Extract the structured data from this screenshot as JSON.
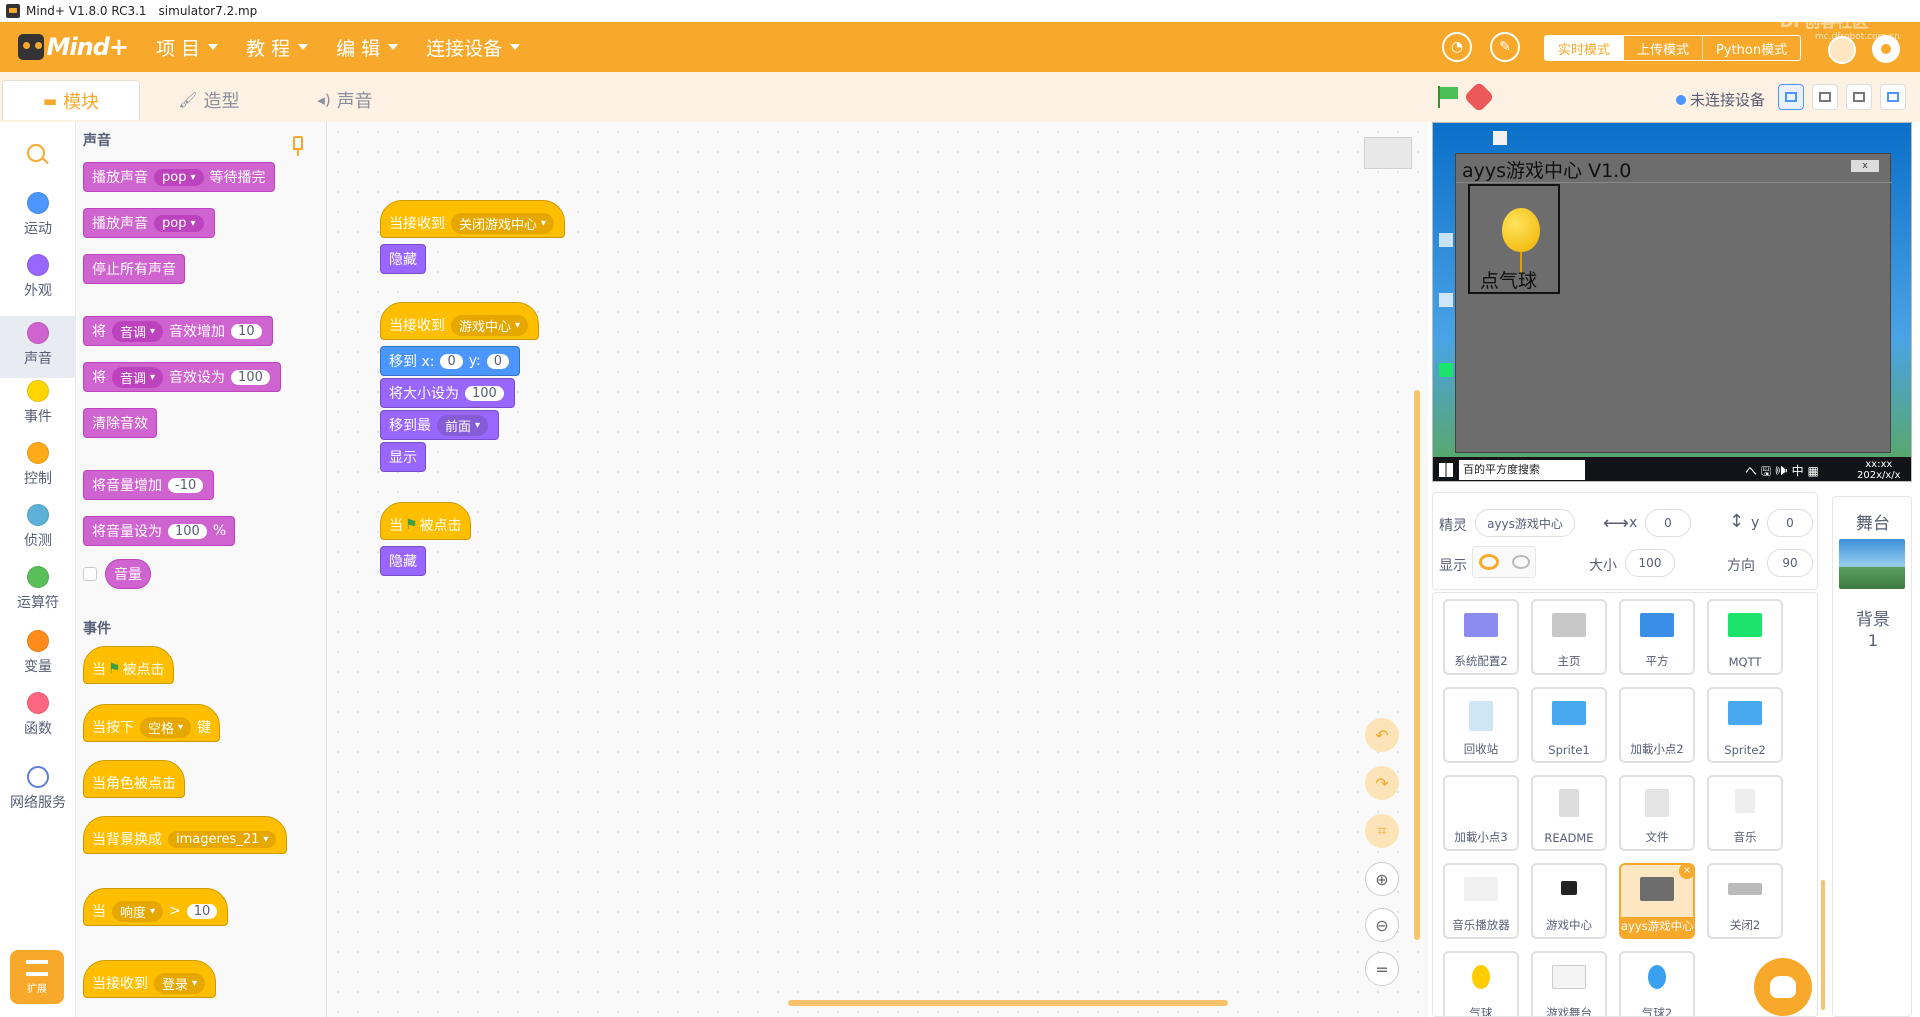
{
  "window": {
    "app": "Mind+ V1.8.0 RC3.1",
    "file": "simulator7.2.mp"
  },
  "menubar": {
    "logo": "Mind+",
    "items": [
      "项 目",
      "教 程",
      "编 辑",
      "连接设备"
    ],
    "modes": [
      "实时模式",
      "上传模式",
      "Python模式"
    ],
    "watermark": "DF创客社区",
    "watermark_sub": "mc.dfrobot.com.cn"
  },
  "tabs": [
    {
      "label": "模块",
      "icon": "blocks-icon"
    },
    {
      "label": "造型",
      "icon": "brush-icon"
    },
    {
      "label": "声音",
      "icon": "speaker-icon"
    }
  ],
  "categories": [
    {
      "label": "运动",
      "color": "#4c97ff"
    },
    {
      "label": "外观",
      "color": "#9966ff"
    },
    {
      "label": "声音",
      "color": "#cf63cf"
    },
    {
      "label": "事件",
      "color": "#ffd500"
    },
    {
      "label": "控制",
      "color": "#ffab19"
    },
    {
      "label": "侦测",
      "color": "#5cb1d6"
    },
    {
      "label": "运算符",
      "color": "#59c059"
    },
    {
      "label": "变量",
      "color": "#ff8c1a"
    },
    {
      "label": "函数",
      "color": "#ff6680"
    },
    {
      "label": "网络服务",
      "color": "#5b80d6"
    }
  ],
  "extension_label": "扩展",
  "palette": {
    "sound_head": "声音",
    "events_head": "事件",
    "sound": {
      "play_wait": "播放声音",
      "play_wait_val": "pop",
      "play_wait_tail": "等待播完",
      "play": "播放声音",
      "play_val": "pop",
      "stop_all": "停止所有声音",
      "change_effect_pre": "将",
      "change_effect_val": "音调",
      "change_effect_mid": "音效增加",
      "change_effect_num": "10",
      "set_effect_pre": "将",
      "set_effect_val": "音调",
      "set_effect_mid": "音效设为",
      "set_effect_num": "100",
      "clear": "清除音效",
      "change_vol": "将音量增加",
      "change_vol_num": "-10",
      "set_vol": "将音量设为",
      "set_vol_num": "100",
      "set_vol_unit": "%",
      "volume": "音量"
    },
    "events": {
      "flag_pre": "当",
      "flag_post": "被点击",
      "key_pre": "当按下",
      "key_val": "空格",
      "key_post": "键",
      "sprite_clicked": "当角色被点击",
      "backdrop": "当背景换成",
      "backdrop_val": "imageres_21",
      "loud_pre": "当",
      "loud_val": "响度",
      "loud_op": ">",
      "loud_num": "10",
      "receive": "当接收到",
      "receive_val": "登录"
    }
  },
  "scripts": {
    "s1_hat": "当接收到",
    "s1_val": "关闭游戏中心",
    "s1_hide": "隐藏",
    "s2_hat": "当接收到",
    "s2_val": "游戏中心",
    "s2_goto": "移到 x:",
    "s2_x": "0",
    "s2_y_label": "y:",
    "s2_y": "0",
    "s2_size": "将大小设为",
    "s2_size_num": "100",
    "s2_layer": "移到最",
    "s2_layer_val": "前面",
    "s2_show": "显示",
    "s3_pre": "当",
    "s3_post": "被点击",
    "s3_hide": "隐藏"
  },
  "stage_header": {
    "status": "未连接设备"
  },
  "stage": {
    "window_title": "ayys游戏中心 V1.0",
    "close": "x",
    "game_label": "点气球",
    "search_placeholder": "百的平方度搜索",
    "tray": "へ 🖫 🕪 中 ▦",
    "clock_line1": "xx:xx",
    "clock_line2": "202x/x/x"
  },
  "sprite_info": {
    "sprite_label": "精灵",
    "sprite_name": "ayys游戏中心",
    "x_label": "x",
    "x": "0",
    "y_label": "y",
    "y": "0",
    "show_label": "显示",
    "size_label": "大小",
    "size": "100",
    "dir_label": "方向",
    "dir": "90"
  },
  "sprites": [
    {
      "name": "系统配置2",
      "thumb": "#8c8cf0"
    },
    {
      "name": "主页",
      "thumb": "#c8c8c8"
    },
    {
      "name": "平方",
      "thumb": "#3a8ee6"
    },
    {
      "name": "MQTT",
      "thumb": "#1be36b"
    },
    {
      "name": "回收站",
      "thumb": "#cfe6f5"
    },
    {
      "name": "Sprite1",
      "thumb": "#4aa8f0"
    },
    {
      "name": "加載小点2",
      "thumb": "#ffffff"
    },
    {
      "name": "Sprite2",
      "thumb": "#4aa8f0"
    },
    {
      "name": "加載小点3",
      "thumb": "#ffffff"
    },
    {
      "name": "README",
      "thumb": "#dddddd"
    },
    {
      "name": "文件",
      "thumb": "#e4e4e4"
    },
    {
      "name": "音乐",
      "thumb": "#eeeeee"
    },
    {
      "name": "音乐播放器",
      "thumb": "#f0f0f0"
    },
    {
      "name": "游戏中心",
      "thumb": "#222222"
    },
    {
      "name": "ayys游戏中心",
      "thumb": "#6d6d6d"
    },
    {
      "name": "关闭2",
      "thumb": "#bbbbbb"
    },
    {
      "name": "气球",
      "thumb": "#ffcc00"
    },
    {
      "name": "游戏舞台",
      "thumb": "#f4f4f4"
    },
    {
      "name": "气球2",
      "thumb": "#3aa0f0"
    }
  ],
  "stage_target": {
    "title": "舞台",
    "label": "背景",
    "count": "1"
  }
}
